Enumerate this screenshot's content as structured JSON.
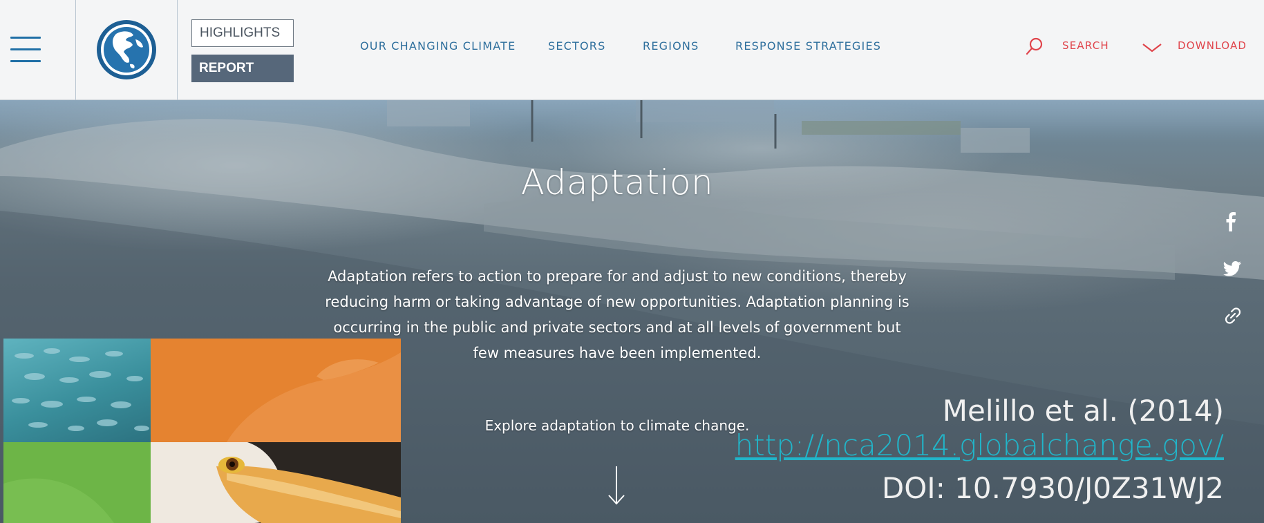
{
  "header": {
    "menu_icon": "hamburger-menu-icon",
    "logo_icon": "globe-logo-icon",
    "highlights_label": "HIGHLIGHTS",
    "report_label": "REPORT",
    "nav": [
      {
        "label": "OUR CHANGING CLIMATE"
      },
      {
        "label": "SECTORS"
      },
      {
        "label": "REGIONS"
      },
      {
        "label": "RESPONSE STRATEGIES"
      }
    ],
    "search_label": "SEARCH",
    "search_icon": "search-icon",
    "download_label": "DOWNLOAD",
    "download_icon": "chevron-down-icon"
  },
  "hero": {
    "title": "Adaptation",
    "description": "Adaptation refers to action to prepare for and adjust to new conditions, thereby reducing harm or taking advantage of new opportunities. Adaptation planning is occurring in the public and private sectors and at all levels of government but few measures have been implemented.",
    "explore": "Explore adaptation to climate change.",
    "arrow_icon": "arrow-down-icon"
  },
  "share": [
    {
      "icon": "facebook-icon"
    },
    {
      "icon": "twitter-icon"
    },
    {
      "icon": "link-icon"
    }
  ],
  "citation": {
    "author": "Melillo et al. (2014)",
    "url": "http://nca2014.globalchange.gov/",
    "doi": "DOI: 10.7930/J0Z31WJ2"
  },
  "colors": {
    "nav_text": "#2d6e9c",
    "accent_red": "#e0454c",
    "report_bg": "#56677a",
    "link_cyan": "#21b5c9"
  }
}
